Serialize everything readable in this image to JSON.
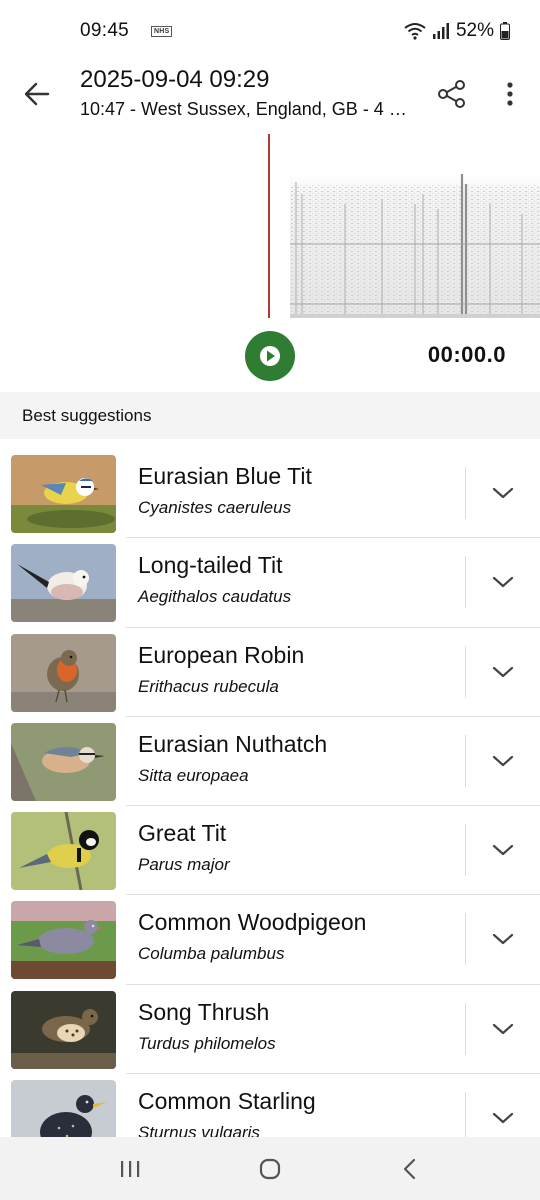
{
  "status_bar": {
    "time": "09:45",
    "nhs_label": "NHS",
    "battery": "52%",
    "icons": [
      "wifi-icon",
      "signal-icon",
      "battery-icon"
    ]
  },
  "app_bar": {
    "title": "2025-09-04 09:29",
    "subtitle": "10:47 - West Sussex, England, GB - 4 S...",
    "icons": [
      "back-arrow-icon",
      "share-icon",
      "more-vert-icon"
    ]
  },
  "player": {
    "time": "00:00.0",
    "play_color": "#2e7d32",
    "playhead_color": "#b03a2e"
  },
  "section": {
    "label": "Best suggestions"
  },
  "suggestions": [
    {
      "common": "Eurasian Blue Tit",
      "scientific": "Cyanistes caeruleus"
    },
    {
      "common": "Long-tailed Tit",
      "scientific": "Aegithalos caudatus"
    },
    {
      "common": "European Robin",
      "scientific": "Erithacus rubecula"
    },
    {
      "common": "Eurasian Nuthatch",
      "scientific": "Sitta europaea"
    },
    {
      "common": "Great Tit",
      "scientific": "Parus major"
    },
    {
      "common": "Common Woodpigeon",
      "scientific": "Columba palumbus"
    },
    {
      "common": "Song Thrush",
      "scientific": "Turdus philomelos"
    },
    {
      "common": "Common Starling",
      "scientific": "Sturnus vulgaris"
    }
  ],
  "nav_bar": {
    "icons": [
      "recents-icon",
      "home-icon",
      "back-icon"
    ]
  }
}
